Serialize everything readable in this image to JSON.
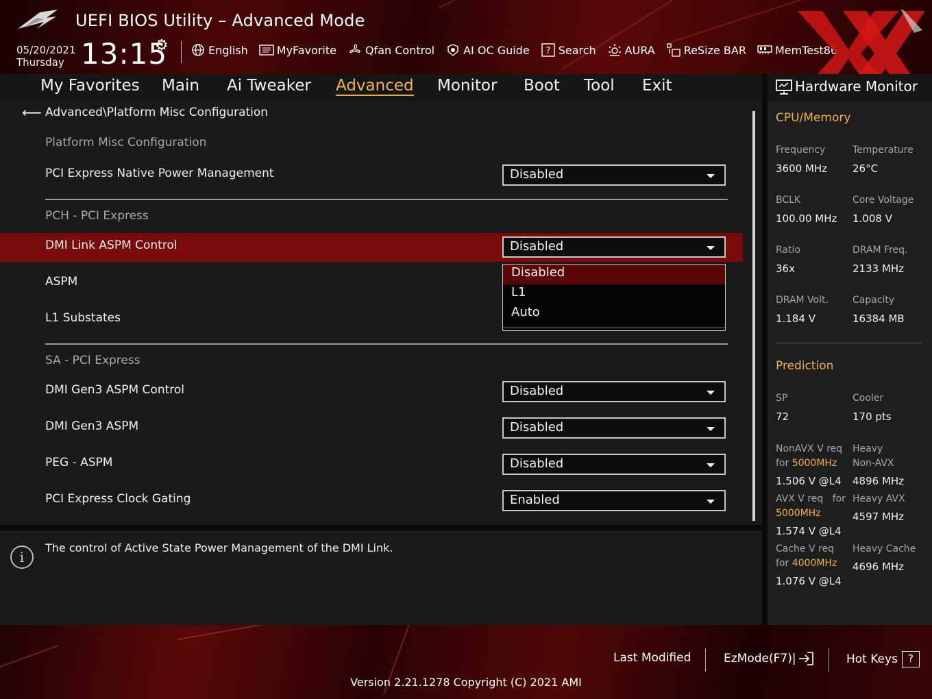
{
  "header": {
    "title": "UEFI BIOS Utility – Advanced Mode",
    "date": "05/20/2021",
    "day": "Thursday",
    "time": "13:15",
    "tools": [
      {
        "label": "English",
        "icon": "globe-icon"
      },
      {
        "label": "MyFavorite",
        "icon": "favorite-list-icon"
      },
      {
        "label": "Qfan Control",
        "icon": "fan-icon"
      },
      {
        "label": "AI OC Guide",
        "icon": "ai-oc-icon"
      },
      {
        "label": "Search",
        "icon": "search-help-icon"
      },
      {
        "label": "AURA",
        "icon": "aura-light-icon"
      },
      {
        "label": "ReSize BAR",
        "icon": "resize-bar-icon"
      },
      {
        "label": "MemTest86",
        "icon": "memtest-icon"
      }
    ]
  },
  "menu": {
    "tabs": [
      "My Favorites",
      "Main",
      "Ai Tweaker",
      "Advanced",
      "Monitor",
      "Boot",
      "Tool",
      "Exit"
    ],
    "active": "Advanced"
  },
  "main": {
    "breadcrumb": "Advanced\\Platform Misc Configuration",
    "sections": {
      "platform": "Platform Misc Configuration",
      "pch": "PCH - PCI Express",
      "sa": "SA - PCI Express"
    },
    "items": {
      "pci_native_pm": {
        "label": "PCI Express Native Power Management",
        "value": "Disabled"
      },
      "dmi_link_aspm": {
        "label": "DMI Link ASPM Control",
        "value": "Disabled"
      },
      "aspm": {
        "label": "ASPM"
      },
      "l1_substates": {
        "label": "L1 Substates"
      },
      "dmi_gen3_aspm_control": {
        "label": "DMI Gen3 ASPM Control",
        "value": "Disabled"
      },
      "dmi_gen3_aspm": {
        "label": "DMI Gen3 ASPM",
        "value": "Disabled"
      },
      "peg_aspm": {
        "label": "PEG - ASPM",
        "value": "Disabled"
      },
      "pci_clock_gating": {
        "label": "PCI Express Clock Gating",
        "value": "Enabled"
      }
    },
    "dropdown_options": [
      "Disabled",
      "L1",
      "Auto"
    ],
    "dropdown_selected": "Disabled"
  },
  "help": {
    "text": "The control of Active State Power Management of the DMI Link."
  },
  "hardware_monitor": {
    "title": "Hardware Monitor",
    "cpu_memory": {
      "heading": "CPU/Memory",
      "frequency": {
        "label": "Frequency",
        "value": "3600 MHz"
      },
      "temperature": {
        "label": "Temperature",
        "value": "26°C"
      },
      "bclk": {
        "label": "BCLK",
        "value": "100.00 MHz"
      },
      "core_voltage": {
        "label": "Core Voltage",
        "value": "1.008 V"
      },
      "ratio": {
        "label": "Ratio",
        "value": "36x"
      },
      "dram_freq": {
        "label": "DRAM Freq.",
        "value": "2133 MHz"
      },
      "dram_volt": {
        "label": "DRAM Volt.",
        "value": "1.184 V"
      },
      "capacity": {
        "label": "Capacity",
        "value": "16384 MB"
      }
    },
    "prediction": {
      "heading": "Prediction",
      "sp": {
        "label": "SP",
        "value": "72"
      },
      "cooler": {
        "label": "Cooler",
        "value": "170 pts"
      },
      "nonavx": {
        "label_line1": "NonAVX V req",
        "label_for": "for",
        "freq": "5000MHz",
        "value": "1.506 V @L4"
      },
      "heavy_nonavx": {
        "label_line1": "Heavy",
        "label_line2": "Non-AVX",
        "value": "4896 MHz"
      },
      "avx": {
        "label_line1": "AVX V req",
        "label_for": "for",
        "freq": "5000MHz",
        "value": "1.574 V @L4"
      },
      "heavy_avx": {
        "label": "Heavy AVX",
        "value": "4597 MHz"
      },
      "cache": {
        "label_line1": "Cache V req",
        "label_for": "for",
        "freq": "4000MHz",
        "value": "1.076 V @L4"
      },
      "heavy_cache": {
        "label": "Heavy Cache",
        "value": "4696 MHz"
      }
    }
  },
  "footer": {
    "last_modified": "Last Modified",
    "ezmode": "EzMode(F7)|",
    "hot_keys": "Hot Keys",
    "hot_keys_key": "?",
    "version": "Version 2.21.1278 Copyright (C) 2021 AMI"
  },
  "colors": {
    "accent": "#f3b048",
    "highlight_row": "#7a0b0b",
    "dropdown_selected": "#5a0606"
  }
}
